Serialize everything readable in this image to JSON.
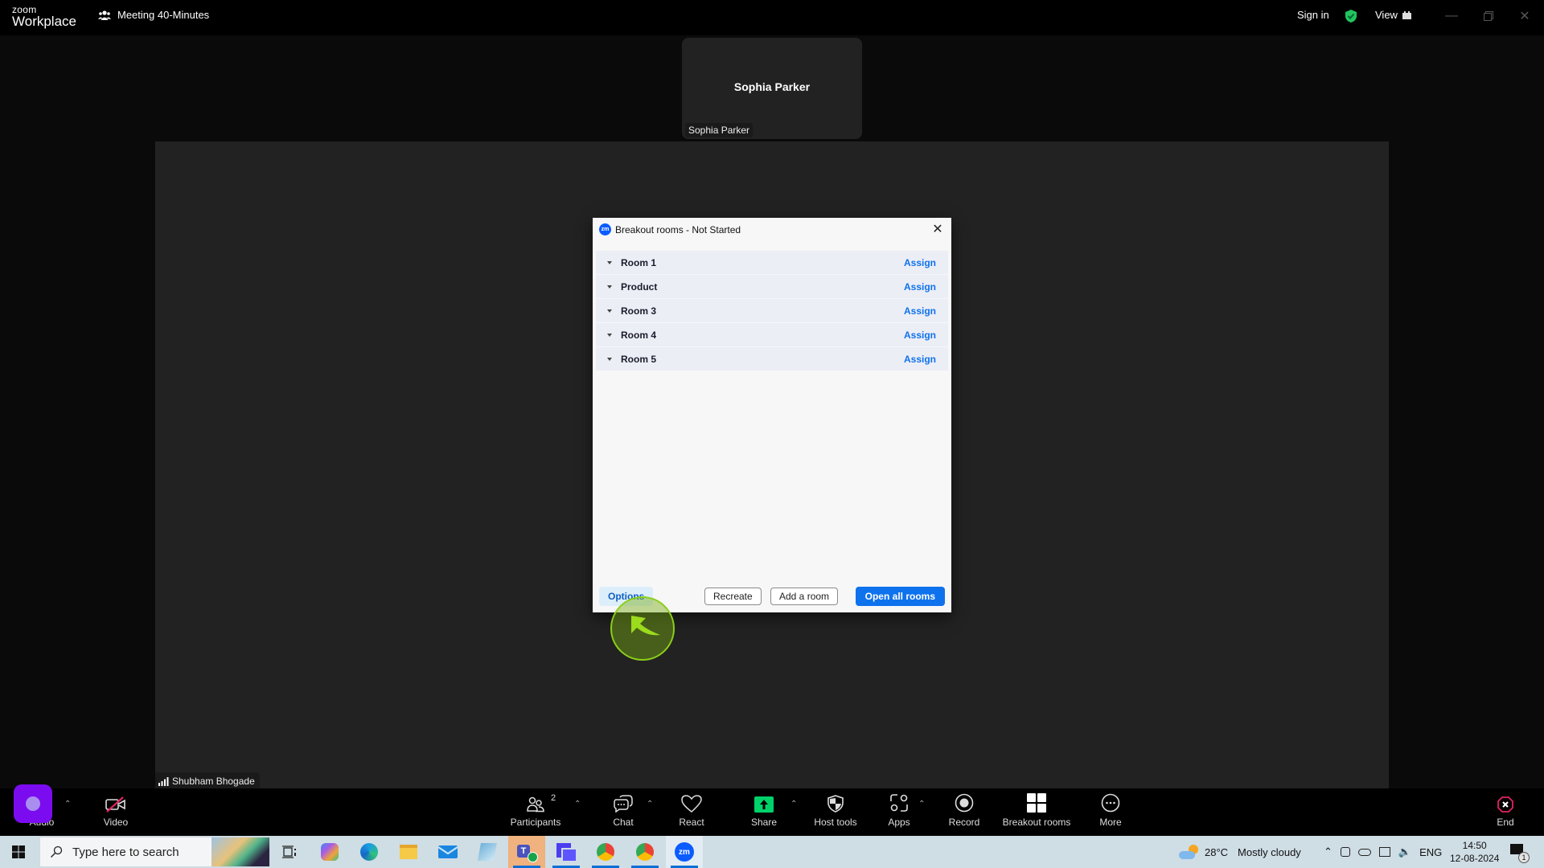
{
  "titlebar": {
    "logo_top": "zoom",
    "logo_bottom": "Workplace",
    "meeting_title": "Meeting 40-Minutes",
    "sign_in": "Sign in",
    "view": "View",
    "security_color": "#22c55e"
  },
  "participants": {
    "tile_name": "Sophia Parker",
    "tile_tag": "Sophia Parker",
    "self_name": "Shubham Bhogade"
  },
  "dialog": {
    "title": "Breakout rooms - Not Started",
    "badge": "zm",
    "rooms": [
      {
        "name": "Room 1",
        "action": "Assign"
      },
      {
        "name": "Product",
        "action": "Assign"
      },
      {
        "name": "Room 3",
        "action": "Assign"
      },
      {
        "name": "Room 4",
        "action": "Assign"
      },
      {
        "name": "Room 5",
        "action": "Assign"
      }
    ],
    "options_label": "Options",
    "recreate_label": "Recreate",
    "add_room_label": "Add a room",
    "open_all_label": "Open all rooms",
    "accent_color": "#0e72ed"
  },
  "toolbar": {
    "audio": "Audio",
    "video": "Video",
    "participants": "Participants",
    "participants_count": "2",
    "chat": "Chat",
    "react": "React",
    "share": "Share",
    "host_tools": "Host tools",
    "apps": "Apps",
    "record": "Record",
    "breakout_rooms": "Breakout rooms",
    "more": "More",
    "end": "End",
    "share_color": "#00d26a",
    "end_color": "#e0245e"
  },
  "taskbar": {
    "search_placeholder": "Type here to search",
    "weather_temp": "28°C",
    "weather_desc": "Mostly cloudy",
    "language": "ENG",
    "time": "14:50",
    "date": "12-08-2024",
    "notifications": "1"
  }
}
